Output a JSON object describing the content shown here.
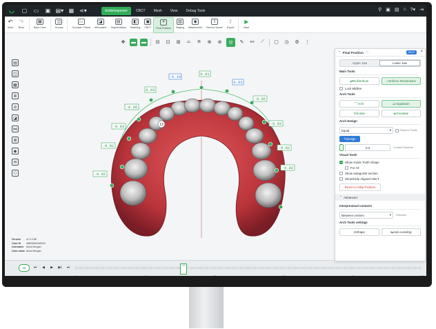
{
  "menubar": {
    "icons": [
      "new-file-icon",
      "open-folder-icon",
      "save-icon",
      "export-icon",
      "cloud-icon",
      "share-icon"
    ],
    "tabs": [
      {
        "label": "SmileInspector",
        "active": true
      },
      {
        "label": "CBCT",
        "active": false
      },
      {
        "label": "Mesh",
        "active": false
      },
      {
        "label": "View",
        "active": false
      },
      {
        "label": "Debug Tools",
        "active": false
      }
    ],
    "right_icons": [
      "search-icon",
      "screenshot-icon",
      "document-icon",
      "hierarchy-icon",
      "help-icon",
      "logout-icon"
    ]
  },
  "ribbon": {
    "items": [
      {
        "label": "Undo",
        "glyph": "↶"
      },
      {
        "label": "Redo",
        "glyph": "↷"
      },
      {
        "label": "Base Case",
        "glyph": "▦"
      },
      {
        "label": "Groups",
        "glyph": "◫"
      },
      {
        "label": "Occlusal / Facial",
        "glyph": "▭"
      },
      {
        "label": "Articulation",
        "glyph": "◪"
      },
      {
        "label": "Segmentation",
        "glyph": "▤"
      },
      {
        "label": "Matching",
        "glyph": "◧"
      },
      {
        "label": "CBCT",
        "glyph": "▣"
      },
      {
        "label": "Final Position",
        "glyph": "⌖",
        "active": true
      },
      {
        "label": "Staging",
        "glyph": "▥"
      },
      {
        "label": "Attachments",
        "glyph": "◉"
      },
      {
        "label": "Send to viewer",
        "glyph": "⇪"
      },
      {
        "label": "Export",
        "glyph": "⇧"
      },
      {
        "label": "Save",
        "glyph": "▶"
      }
    ]
  },
  "toolbar": [
    "move-icon",
    "jaw-view-icon",
    "lower-view-icon",
    "tooth-upper-icon",
    "tooth-side-icon",
    "tooth-front-icon",
    "arch-upper-icon",
    "arch-lower-icon",
    "occlusion-icon",
    "occlusion-alt-icon",
    "tooth-select-icon",
    "tooth-edit-icon",
    "attach-icon",
    "measure-icon",
    "screen-capture-icon",
    "clock-icon",
    "settings-icon",
    "more-icon"
  ],
  "leftrail": [
    "layers-icon",
    "ruler-icon",
    "tooth-grid-icon",
    "checklist-icon",
    "cross-section-icon",
    "superimpose-icon",
    "collision-icon",
    "bolton-icon",
    "overjet-icon",
    "comment-icon",
    "ipr-icon"
  ],
  "viewport": {
    "labels": [
      "-0.10",
      "0.01",
      "0.03",
      "0.03",
      "-0.02",
      "-0.05",
      "-0.03",
      "-0.03",
      "-0.02",
      "-0.02",
      "-0.02",
      "-0.02"
    ],
    "tooth_number": "13"
  },
  "info": [
    {
      "k": "Version",
      "v": "v1.0.2.88"
    },
    {
      "k": "Case ID",
      "v": "45625452455412"
    },
    {
      "k": "Username",
      "v": "Anna Morgan"
    },
    {
      "k": "Case name",
      "v": "Anna Morgan"
    }
  ],
  "timeline": {
    "step": "15",
    "marker": "13",
    "ticks": [
      "0",
      "10",
      "20",
      "30",
      "40",
      "50"
    ]
  },
  "panel": {
    "title": "Final Position",
    "help": "HELP",
    "jaw_upper": "Upper Jaw",
    "jaw_lower": "Lower Jaw",
    "main_tools": "Main Tools",
    "redistribute": "Redistribute",
    "enforce": "Enforce Restrictions",
    "lock_midline": "Lock Midline",
    "arch_tools": "Arch Tools",
    "arch": "Arch",
    "angulation": "Angulation",
    "rotate": "Rotate",
    "translate": "Translate",
    "arch_design": "Arch Design",
    "arch_shape": "Equal",
    "observe_points": "Observe Points",
    "design": "Design",
    "distance_value": "0.0",
    "distance_label": "Contact Distance",
    "visual_tools": "Visual Tools",
    "show_guide": "Show Guide Tooth Shape",
    "for_all": "For All",
    "show_antagonist": "Show antagonist section",
    "show_cbct": "Show/Hide Aligned CBCT",
    "reset": "Reset to Initial Position",
    "advanced": "Advanced",
    "interproximal": "Interproximal contacts",
    "between": "Between centers",
    "direction": "Direction",
    "arch_settings": "Arch Tools settings",
    "shape": "Shape",
    "auto_leveling": "Auto Leveling"
  }
}
